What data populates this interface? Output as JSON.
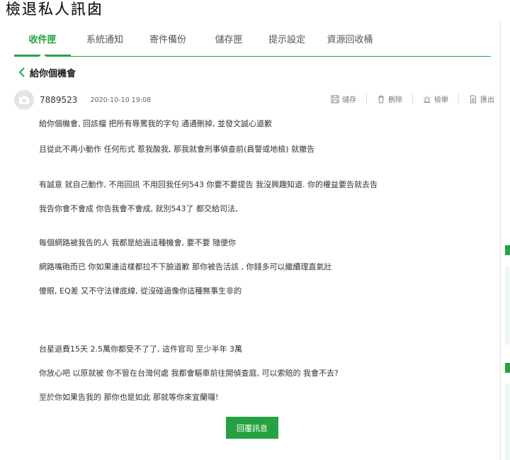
{
  "overlay_title": "檢退私人訊囱",
  "tabs": [
    {
      "label": "收件匣",
      "active": true
    },
    {
      "label": "系統通知",
      "active": false
    },
    {
      "label": "寄件備份",
      "active": false
    },
    {
      "label": "儲存匣",
      "active": false
    },
    {
      "label": "提示設定",
      "active": false
    },
    {
      "label": "資源回收桶",
      "active": false
    }
  ],
  "message": {
    "subject": "給你個機會",
    "sender": "7889523",
    "date": "2020-10-10 19:08",
    "actions": {
      "save": "儲存",
      "delete": "刪除",
      "report": "檢舉",
      "export": "匯出"
    },
    "body": [
      "給你個機會, 回該檔 把所有辱罵我的字句 通通刪掉, 並發文誠心道歉",
      "且從此不再小動作 任何形式 惹我酸我, 那我就會刑事偵查前(員警或地檢) 就撤告",
      "有誠意 就自己動作, 不用回訊 不用回我任何543 你要不要提告 我沒興趣知道. 你的權益要告就去告",
      "我告你會不會成 你告我會不會成, 就別543了 都交給司法,",
      "每個網路被我告的人 我都是給過這種機會, 要不要 隨便你",
      "網路嘴砲而已 你如果連這樣都拉不下臉道歉 那你被告活該 , 你錢多可以繼續理直氣壯",
      "傻眼, EQ差 又不守法律底線, 從沒碰過像你這種無事生非的",
      "台星退費15天 2.5萬你都受不了了, 這件官司 至少半年 3萬",
      "你放心吧 以原就被 你不管在台灣何處 我都會驅車前往開偵查庭, 可以索賠的 我會不去?",
      "至於你如果告我的 那你也是如此 那就等你來宜蘭囉!"
    ],
    "reply_label": "回覆訊息"
  },
  "colors": {
    "accent": "#27a243"
  }
}
